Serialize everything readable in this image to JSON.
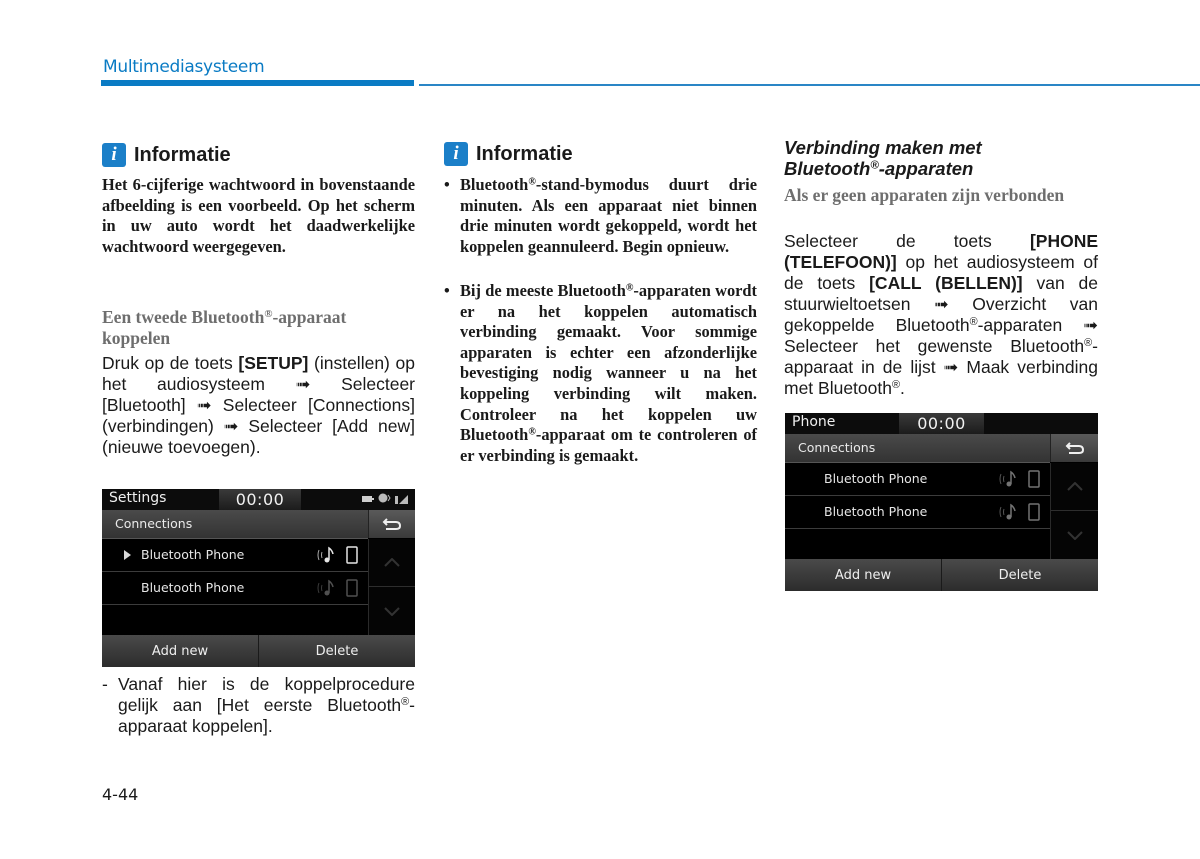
{
  "header": {
    "section_title": "Multimediasysteem"
  },
  "col1": {
    "info_box": {
      "icon": "info-icon",
      "icon_glyph": "i",
      "title": "Informatie",
      "text": "Het 6-cijferige wachtwoord in bovenstaande afbeelding is een voorbeeld. Op het scherm in uw auto wordt het daadwerkelijke wachtwoord weergegeven."
    },
    "subheading_part1": "Een tweede Bluetooth",
    "subheading_reg": "®",
    "subheading_part2": "-apparaat koppelen",
    "instructions": {
      "p1": "Druk op de toets ",
      "setup_key": "[SETUP]",
      "p2": " (instellen) op het audiosysteem ",
      "arrow": "➟",
      "p3": " Selecteer [Bluetooth] ",
      "p4": " Selecteer [Connections] (verbindingen) ",
      "p5": " Selecteer [Add new] (nieuwe toevoegen)."
    },
    "note": {
      "dash": "-",
      "text_part1": "Vanaf hier is de koppelprocedure gelijk aan [Het eerste Bluetooth",
      "reg": "®",
      "text_part2": "-apparaat koppelen]."
    }
  },
  "screen1": {
    "title": "Settings",
    "clock": "00:00",
    "status_icons": [
      "battery-icon",
      "bluetooth-audio-icon",
      "signal-icon"
    ],
    "subheader": "Connections",
    "back_icon": "back-arrow-icon",
    "rows": [
      {
        "label": "Bluetooth Phone",
        "selected": true,
        "icons": [
          "bluetooth-audio-icon",
          "phone-icon"
        ]
      },
      {
        "label": "Bluetooth Phone",
        "selected": false,
        "icons": [
          "bluetooth-audio-icon",
          "phone-icon"
        ]
      }
    ],
    "scroll_up_icon": "chevron-up-icon",
    "scroll_down_icon": "chevron-down-icon",
    "buttons": [
      "Add new",
      "Delete"
    ]
  },
  "col2": {
    "info_box": {
      "icon": "info-icon",
      "icon_glyph": "i",
      "title": "Informatie"
    },
    "bullets": [
      {
        "part1": "Bluetooth",
        "reg": "®",
        "part2": "-stand-bymodus duurt drie minuten. Als een apparaat niet binnen drie minuten wordt gekoppeld, wordt het koppelen geannuleerd. Begin opnieuw."
      },
      {
        "part1": "Bij de meeste Bluetooth",
        "reg": "®",
        "part2": "-apparaten wordt er na het koppelen automatisch verbinding gemaakt. Voor sommige apparaten is echter een afzonderlijke bevestiging nodig wanneer u na het koppeling verbinding wilt maken. Controleer na het koppelen uw Bluetooth",
        "reg2": "®",
        "part3": "-apparaat om te controleren of er verbinding is gemaakt."
      }
    ]
  },
  "col3": {
    "section_heading_line1": "Verbinding maken met",
    "section_heading_line2a": "Bluetooth",
    "section_heading_reg": "®",
    "section_heading_line2b": "-apparaten",
    "subheading": "Als er geen apparaten zijn verbonden",
    "instructions": {
      "p1": "Selecteer de toets ",
      "phone_key": "[PHONE (TELEFOON)]",
      "p2": " op het audiosysteem of de toets ",
      "call_key": "[CALL (BELLEN)]",
      "p3": " van de stuurwieltoetsen ",
      "arrow": "➟",
      "p4": " Overzicht van gekoppelde Bluetooth",
      "reg": "®",
      "p5": "-apparaten ",
      "p6": " Selecteer het gewenste Bluetooth",
      "p7": "-apparaat in de lijst ",
      "p8": " Maak verbinding met Bluetooth",
      "p9": "."
    }
  },
  "screen2": {
    "title": "Phone",
    "clock": "00:00",
    "subheader": "Connections",
    "back_icon": "back-arrow-icon",
    "rows": [
      {
        "label": "Bluetooth Phone",
        "selected": false,
        "icons": [
          "bluetooth-audio-icon",
          "phone-icon"
        ]
      },
      {
        "label": "Bluetooth Phone",
        "selected": false,
        "icons": [
          "bluetooth-audio-icon",
          "phone-icon"
        ]
      }
    ],
    "scroll_up_icon": "chevron-up-icon",
    "scroll_down_icon": "chevron-down-icon",
    "buttons": [
      "Add new",
      "Delete"
    ]
  },
  "footer": {
    "page_number": "4-44"
  },
  "colors": {
    "accent_blue": "#0a7bc4",
    "info_icon_blue": "#1b7fc8",
    "subheading_gray": "#6e6e6e"
  }
}
